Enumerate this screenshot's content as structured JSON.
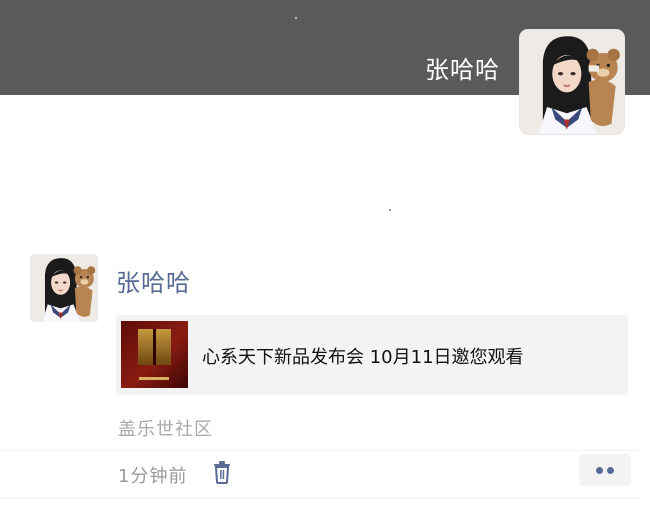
{
  "header": {
    "user_name": "张哈哈",
    "background_color": "#5a5a5a"
  },
  "post": {
    "author": "张哈哈",
    "author_color": "#576b95",
    "share": {
      "title": "心系天下新品发布会 10月11日邀您观看",
      "thumbnail_icon": "product-launch-thumbnail"
    },
    "source": "盖乐世社区",
    "time": "1分钟前",
    "delete_icon": "trash-icon",
    "more_icon": "more-dots-icon"
  }
}
